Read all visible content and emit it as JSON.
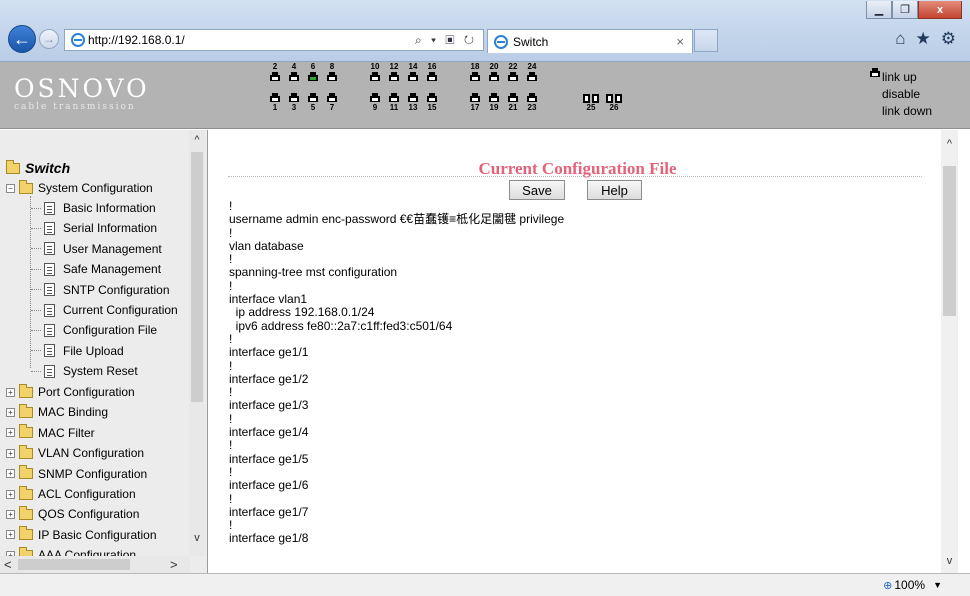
{
  "browser": {
    "url": "http://192.168.0.1/",
    "tab_title": "Switch",
    "addr_tools": "⌕ ▾ ▣ ↻",
    "tab_close": "×",
    "tools": [
      "⌂",
      "★",
      "⚙"
    ],
    "zoom": "100%",
    "zoom_icon": "⊕",
    "window_buttons": [
      "▁",
      "❐",
      "x"
    ]
  },
  "device": {
    "logo_main": "OSNOVO",
    "logo_sub": "cable transmission",
    "ports_top": [
      {
        "num": "2",
        "status": "down"
      },
      {
        "num": "4",
        "status": "down"
      },
      {
        "num": "6",
        "status": "up"
      },
      {
        "num": "8",
        "status": "down"
      },
      {
        "num": "10",
        "status": "down"
      },
      {
        "num": "12",
        "status": "down"
      },
      {
        "num": "14",
        "status": "down"
      },
      {
        "num": "16",
        "status": "down"
      },
      {
        "num": "18",
        "status": "down"
      },
      {
        "num": "20",
        "status": "down"
      },
      {
        "num": "22",
        "status": "down"
      },
      {
        "num": "24",
        "status": "down"
      }
    ],
    "ports_bottom": [
      {
        "num": "1",
        "status": "down"
      },
      {
        "num": "3",
        "status": "down"
      },
      {
        "num": "5",
        "status": "down"
      },
      {
        "num": "7",
        "status": "down"
      },
      {
        "num": "9",
        "status": "down"
      },
      {
        "num": "11",
        "status": "down"
      },
      {
        "num": "13",
        "status": "down"
      },
      {
        "num": "15",
        "status": "down"
      },
      {
        "num": "17",
        "status": "down"
      },
      {
        "num": "19",
        "status": "down"
      },
      {
        "num": "21",
        "status": "down"
      },
      {
        "num": "23",
        "status": "down"
      }
    ],
    "fiber_ports": [
      {
        "num": "25"
      },
      {
        "num": "26"
      }
    ],
    "legend": [
      {
        "label": "link up",
        "status": "up"
      },
      {
        "label": "disable",
        "status": "dis"
      },
      {
        "label": "link down",
        "status": "down"
      }
    ]
  },
  "sidebar": {
    "root": "Switch",
    "system_group": "System Configuration",
    "system_items": [
      "Basic Information",
      "Serial Information",
      "User Management",
      "Safe Management",
      "SNTP Configuration",
      "Current Configuration",
      "Configuration File",
      "File Upload",
      "System Reset"
    ],
    "groups": [
      "Port Configuration",
      "MAC Binding",
      "MAC Filter",
      "VLAN Configuration",
      "SNMP Configuration",
      "ACL Configuration",
      "QOS Configuration",
      "IP Basic Configuration",
      "AAA Configuration"
    ]
  },
  "main": {
    "title": "Current Configuration File",
    "save_label": "Save",
    "help_label": "Help",
    "config_lines": [
      "!",
      "username admin enc-password €€苗蠢镬≡柢化足闔毽 privilege",
      "!",
      "vlan database",
      "!",
      "spanning-tree mst configuration",
      "!",
      "interface vlan1",
      "  ip address 192.168.0.1/24",
      "  ipv6 address fe80::2a7:c1ff:fed3:c501/64",
      "!",
      "interface ge1/1",
      "!",
      "interface ge1/2",
      "!",
      "interface ge1/3",
      "!",
      "interface ge1/4",
      "!",
      "interface ge1/5",
      "!",
      "interface ge1/6",
      "!",
      "interface ge1/7",
      "!",
      "interface ge1/8"
    ]
  },
  "scroll_arrows": {
    "up": "^",
    "down": "v",
    "left": "<",
    "right": ">"
  }
}
